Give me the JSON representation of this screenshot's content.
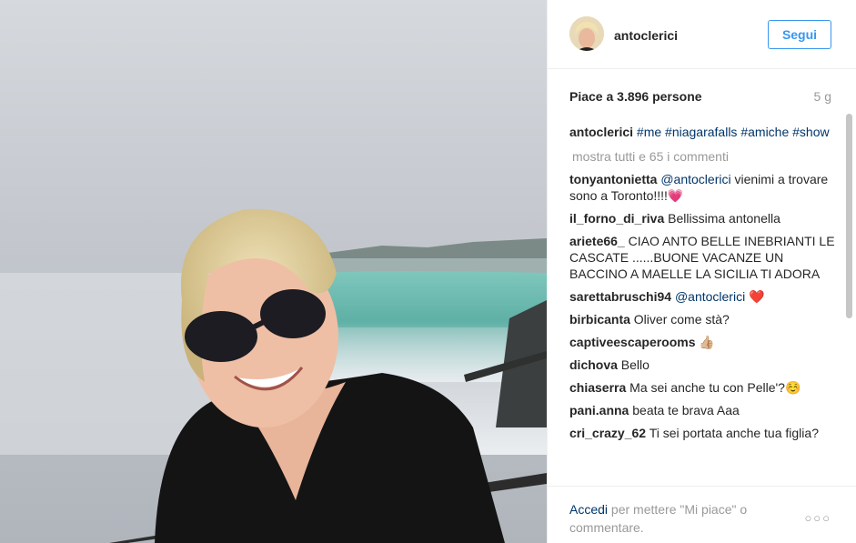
{
  "post": {
    "username": "antoclerici",
    "follow_label": "Segui",
    "likes_text": "Piace a 3.896 persone",
    "time_ago": "5 g"
  },
  "caption": {
    "user": "antoclerici",
    "tags": [
      "#me",
      "#niagarafalls",
      "#amiche",
      "#show"
    ]
  },
  "show_all_comments": "mostra tutti e 65 i commenti",
  "comments": [
    {
      "user": "tonyantonietta",
      "mention": "@antoclerici",
      "text": " vienimi a trovare sono a Toronto!!!!💗"
    },
    {
      "user": "il_forno_di_riva",
      "mention": "",
      "text": "Bellissima antonella"
    },
    {
      "user": "ariete66_",
      "mention": "",
      "text": "CIAO ANTO BELLE INEBRIANTI LE CASCATE ......BUONE VACANZE UN BACCINO A MAELLE LA SICILIA TI ADORA"
    },
    {
      "user": "sarettabruschi94",
      "mention": "@antoclerici",
      "text": " ❤️"
    },
    {
      "user": "birbicanta",
      "mention": "",
      "text": "Oliver come stà?"
    },
    {
      "user": "captiveescaperooms",
      "mention": "",
      "text": "👍🏼"
    },
    {
      "user": "dichova",
      "mention": "",
      "text": "Bello"
    },
    {
      "user": "chiaserra",
      "mention": "",
      "text": "Ma sei anche tu con Pelle'?☺️"
    },
    {
      "user": "pani.anna",
      "mention": "",
      "text": "beata te brava Aaa"
    },
    {
      "user": "cri_crazy_62",
      "mention": "",
      "text": "Ti sei portata anche tua figlia?"
    }
  ],
  "footer": {
    "login_link": "Accedi",
    "login_text": " per mettere \"Mi piace\" o commentare.",
    "more_icon": "more-dots-icon"
  }
}
